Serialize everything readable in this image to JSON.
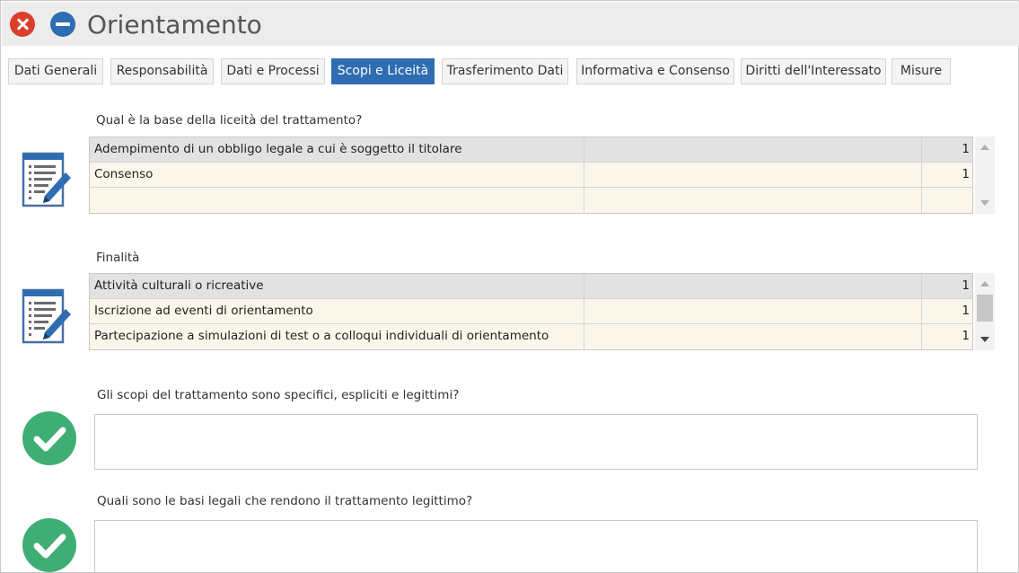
{
  "window": {
    "title": "Orientamento"
  },
  "tabs": [
    {
      "label": "Dati Generali"
    },
    {
      "label": "Responsabilità"
    },
    {
      "label": "Dati e Processi"
    },
    {
      "label": "Scopi e Liceità"
    },
    {
      "label": "Trasferimento Dati"
    },
    {
      "label": "Informativa e Consenso"
    },
    {
      "label": "Diritti dell'Interessato"
    },
    {
      "label": "Misure"
    }
  ],
  "active_tab": "Scopi e Liceità",
  "sections": {
    "lawfulness": {
      "label": "Qual è la base della liceità del trattamento?",
      "rows": [
        {
          "name": "Adempimento di un obbligo legale a cui è soggetto il titolare",
          "value": "",
          "count": "1"
        },
        {
          "name": "Consenso",
          "value": "",
          "count": "1"
        },
        {
          "name": "",
          "value": "",
          "count": ""
        }
      ]
    },
    "purposes": {
      "label": "Finalità",
      "rows": [
        {
          "name": "Attività culturali o ricreative",
          "value": "",
          "count": "1"
        },
        {
          "name": "Iscrizione ad eventi di orientamento",
          "value": "",
          "count": "1"
        },
        {
          "name": "Partecipazione a simulazioni di test o a colloqui individuali di orientamento",
          "value": "",
          "count": "1"
        }
      ]
    },
    "specific_purposes": {
      "label": "Gli scopi del trattamento sono specifici, espliciti e legittimi?",
      "value": ""
    },
    "legal_bases": {
      "label": "Quali sono le basi legali che rendono il trattamento legittimo?",
      "value": ""
    }
  },
  "colors": {
    "accent": "#2e6db2",
    "close": "#d9402b",
    "check": "#3fae74",
    "row_bg": "#faf6ea",
    "row_selected": "#e2e2e2"
  },
  "icons": {
    "close": "close-icon",
    "minimize": "minimize-icon",
    "edit_document": "edit-document-icon",
    "check": "check-circle-icon"
  }
}
